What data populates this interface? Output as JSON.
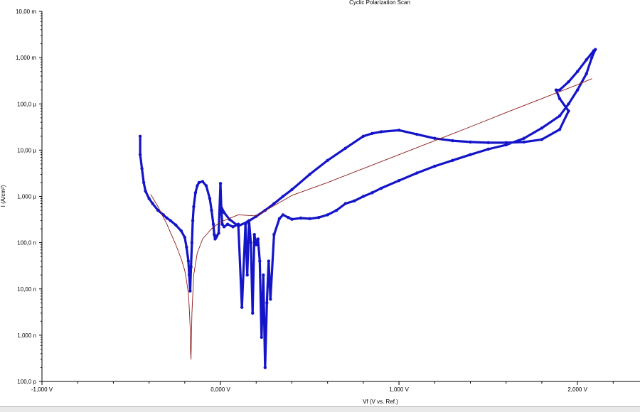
{
  "chart_data": {
    "type": "scatter",
    "title": "Cyclic Polarization Scan",
    "xlabel": "Vf (V vs. Ref.)",
    "ylabel": "I (A/cm²)",
    "y_scale": "log",
    "xlim": [
      -1.0,
      2.35
    ],
    "ylim": [
      1e-10,
      0.01
    ],
    "x_ticks": [
      {
        "value": -1.0,
        "label": "-1,000 V"
      },
      {
        "value": 0.0,
        "label": "0,000 V"
      },
      {
        "value": 1.0,
        "label": "1,000 V"
      },
      {
        "value": 2.0,
        "label": "2,000 V"
      }
    ],
    "y_ticks": [
      {
        "value": 0.01,
        "label": "10,00 m"
      },
      {
        "value": 0.001,
        "label": "1,000 m"
      },
      {
        "value": 0.0001,
        "label": "100,0 µ"
      },
      {
        "value": 1e-05,
        "label": "10,00 µ"
      },
      {
        "value": 1e-06,
        "label": "1,000 µ"
      },
      {
        "value": 1e-07,
        "label": "100,0 n"
      },
      {
        "value": 1e-08,
        "label": "10,00 n"
      },
      {
        "value": 1e-09,
        "label": "1,000 n"
      },
      {
        "value": 1e-10,
        "label": "100,0 p"
      }
    ],
    "grid": false,
    "series": [
      {
        "color": "#1414c8",
        "x": [
          -0.45,
          -0.45,
          -0.44,
          -0.43,
          -0.42,
          -0.4,
          -0.38,
          -0.35,
          -0.32,
          -0.3,
          -0.28,
          -0.25,
          -0.22,
          -0.2,
          -0.19,
          -0.18,
          -0.175,
          -0.17,
          -0.165,
          -0.16,
          -0.155,
          -0.15,
          -0.14,
          -0.13,
          -0.12,
          -0.1,
          -0.08,
          -0.06,
          -0.05,
          -0.04,
          -0.035,
          -0.03,
          -0.025,
          -0.02,
          -0.01,
          0.0,
          0.005,
          0.01,
          0.02,
          0.04,
          0.07,
          0.1,
          0.12,
          0.14,
          0.15,
          0.16,
          0.17,
          0.18,
          0.19,
          0.2,
          0.21,
          0.22,
          0.23,
          0.24,
          0.25,
          0.26,
          0.27,
          0.28,
          0.3,
          0.33,
          0.35,
          0.38,
          0.4,
          0.45,
          0.5,
          0.55,
          0.6,
          0.65,
          0.7,
          0.75,
          0.8,
          0.85,
          0.9,
          1.0,
          1.1,
          1.2,
          1.3,
          1.4,
          1.5,
          1.6,
          1.7,
          1.8,
          1.9,
          1.95,
          2.0,
          2.05,
          2.08,
          2.1,
          2.09,
          2.05,
          2.0,
          1.95,
          1.9,
          1.88,
          1.9,
          1.95,
          1.9,
          1.8,
          1.7,
          1.6,
          1.5,
          1.4,
          1.3,
          1.2,
          1.1,
          1.0,
          0.9,
          0.85,
          0.8,
          0.7,
          0.6,
          0.5,
          0.4,
          0.35,
          0.3,
          0.25,
          0.2,
          0.15,
          0.1,
          0.05,
          0.02,
          0.0
        ],
        "y": [
          2e-05,
          8e-06,
          4e-06,
          2e-06,
          1.3e-06,
          9e-07,
          7e-07,
          5e-07,
          4e-07,
          3.4e-07,
          3e-07,
          2.4e-07,
          1.8e-07,
          1.3e-07,
          8e-08,
          4e-08,
          2e-08,
          9e-09,
          3e-08,
          1e-07,
          3e-07,
          6e-07,
          1.2e-06,
          1.7e-06,
          2e-06,
          2.1e-06,
          1.7e-06,
          9e-07,
          5e-07,
          2.5e-07,
          1.5e-07,
          1.2e-07,
          1.3e-07,
          1.4e-07,
          1.6e-07,
          1.9e-06,
          5e-07,
          2.5e-07,
          2.2e-07,
          2.5e-07,
          2.2e-07,
          2.5e-07,
          4e-09,
          2.5e-07,
          2e-08,
          3e-07,
          1e-07,
          3e-09,
          1.5e-07,
          9e-08,
          1.2e-07,
          4e-08,
          9e-10,
          2e-08,
          2e-10,
          5e-09,
          4e-08,
          6e-09,
          1.5e-07,
          3.3e-07,
          4e-07,
          3.5e-07,
          3.2e-07,
          3.4e-07,
          3.3e-07,
          3.5e-07,
          4e-07,
          5e-07,
          7e-07,
          8e-07,
          1e-06,
          1.2e-06,
          1.5e-06,
          2.2e-06,
          3.2e-06,
          4.5e-06,
          6e-06,
          8e-06,
          1.05e-05,
          1.3e-05,
          1.8e-05,
          3e-05,
          5.5e-05,
          0.0001,
          0.0002,
          0.00045,
          0.001,
          0.0015,
          0.0014,
          0.0009,
          0.0005,
          0.0003,
          0.0002,
          0.0002,
          0.00013,
          7e-05,
          2.8e-05,
          1.7e-05,
          1.5e-05,
          1.45e-05,
          1.45e-05,
          1.5e-05,
          1.6e-05,
          1.8e-05,
          2.2e-05,
          2.7e-05,
          2.5e-05,
          2.3e-05,
          2e-05,
          1.1e-05,
          6e-06,
          3e-06,
          1.4e-06,
          1e-06,
          7e-07,
          5e-07,
          3.7e-07,
          2.8e-07,
          2.3e-07,
          3.2e-07,
          4.5e-07,
          6.5e-07
        ]
      },
      {
        "color": "#8b1a1a",
        "x": [
          -0.39,
          -0.35,
          -0.3,
          -0.25,
          -0.22,
          -0.2,
          -0.19,
          -0.18,
          -0.175,
          -0.17,
          -0.168,
          -0.165,
          -0.16,
          -0.15,
          -0.13,
          -0.1,
          -0.05,
          0.0,
          0.1,
          0.2,
          0.4,
          0.6,
          0.8,
          1.0,
          1.2,
          1.4,
          1.6,
          1.8,
          2.0,
          2.08
        ],
        "y": [
          1.1e-06,
          6e-07,
          2.5e-07,
          9e-08,
          4.5e-08,
          2.5e-08,
          1.5e-08,
          8e-09,
          4e-09,
          1.5e-09,
          5e-10,
          3e-10,
          3e-09,
          2e-08,
          6e-08,
          1.2e-07,
          2e-07,
          2.8e-07,
          4e-07,
          3.8e-07,
          1.05e-06,
          2e-06,
          4e-06,
          8e-06,
          1.6e-05,
          3.2e-05,
          6.5e-05,
          0.00013,
          0.00026,
          0.00035
        ]
      }
    ]
  }
}
